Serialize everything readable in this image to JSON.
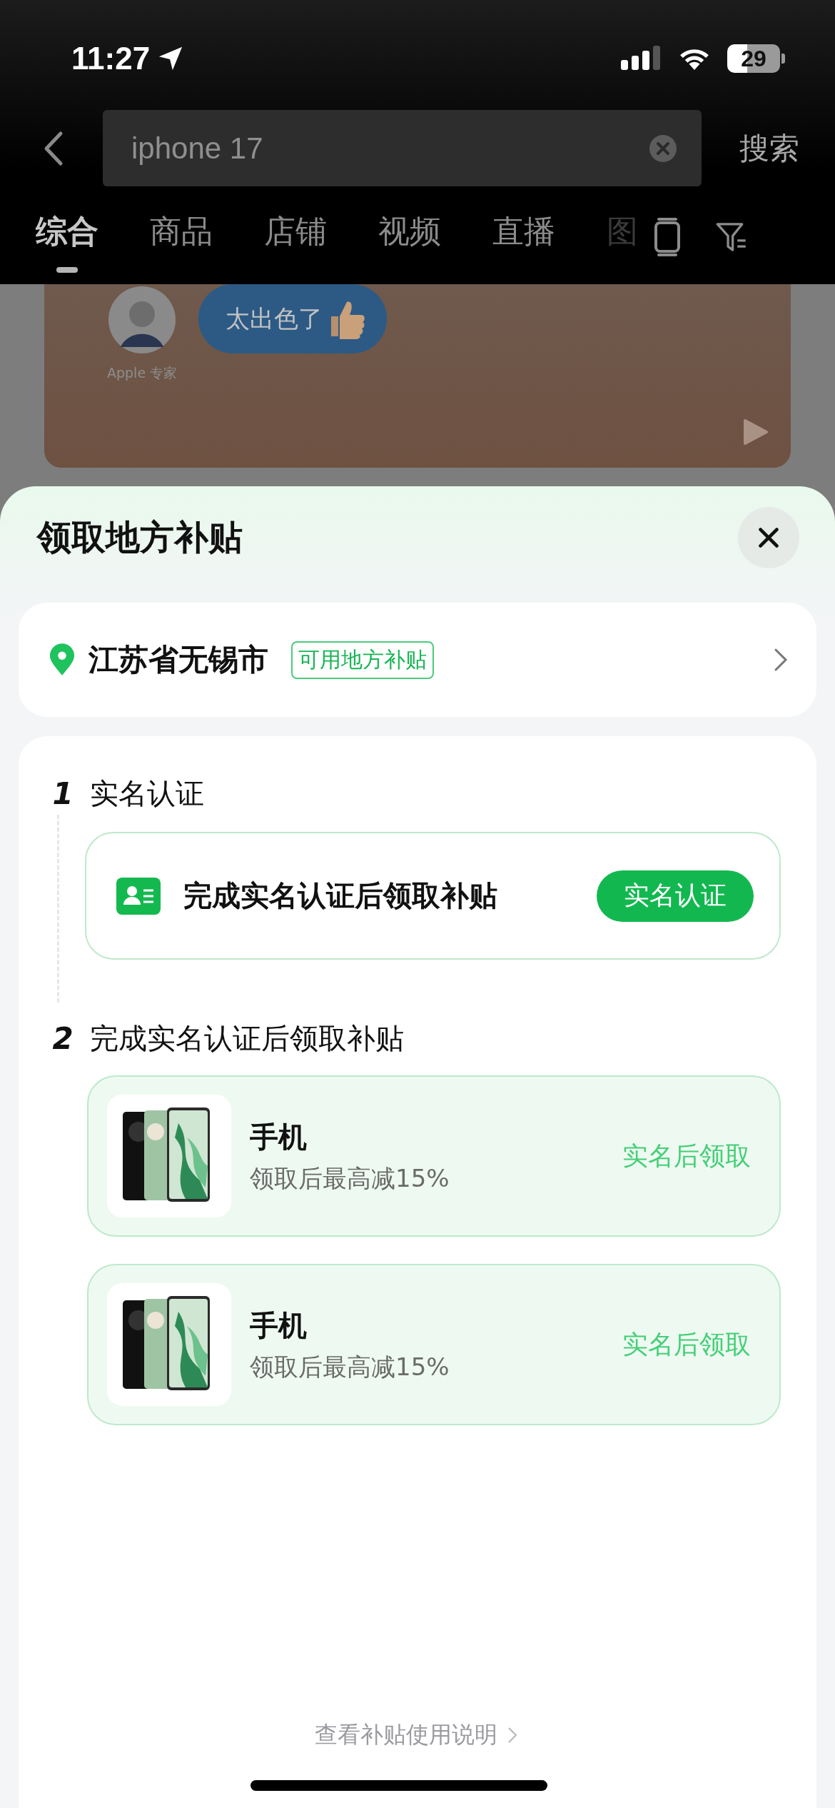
{
  "status_bar": {
    "time": "11:27",
    "battery": "29"
  },
  "search": {
    "value": "iphone 17",
    "button": "搜索"
  },
  "tabs": [
    {
      "label": "综合",
      "selected": true
    },
    {
      "label": "商品",
      "selected": false
    },
    {
      "label": "店铺",
      "selected": false
    },
    {
      "label": "视频",
      "selected": false
    },
    {
      "label": "直播",
      "selected": false
    },
    {
      "label": "图",
      "selected": false
    }
  ],
  "background_post": {
    "bubble": "太出色了",
    "avatar_caption": "Apple 专家"
  },
  "sheet": {
    "title": "领取地方补贴",
    "location": {
      "name": "江苏省无锡市",
      "tag": "可用地方补贴"
    },
    "steps": [
      {
        "number": "1",
        "title": "实名认证",
        "kind": "verify",
        "text": "完成实名认证后领取补贴",
        "button": "实名认证"
      },
      {
        "number": "2",
        "title": "完成实名认证后领取补贴",
        "kind": "products",
        "products": [
          {
            "name": "手机",
            "desc": "领取后最高减15%",
            "action": "实名后领取"
          },
          {
            "name": "手机",
            "desc": "领取后最高减15%",
            "action": "实名后领取"
          }
        ]
      }
    ],
    "footer_link": "查看补贴使用说明"
  }
}
